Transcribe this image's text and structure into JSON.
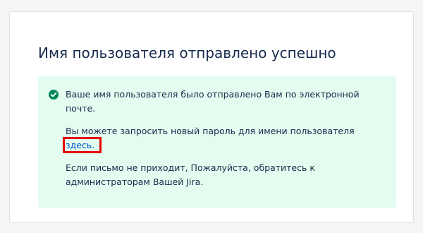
{
  "title": "Имя пользователя отправлено успешно",
  "message": {
    "line1": "Ваше имя пользователя было отправлено Вам по электронной почте.",
    "line2_text": "Вы можете запросить новый пароль для имени пользователя ",
    "line2_link": "здесь.",
    "line3": "Если письмо не приходит, Пожалуйста, обратитесь к администраторам Вашей Jira."
  },
  "colors": {
    "success_bg": "#e3fcef",
    "success_icon": "#00875a",
    "link": "#0052cc",
    "highlight": "#e60000"
  },
  "icons": {
    "status": "check-circle-icon"
  }
}
